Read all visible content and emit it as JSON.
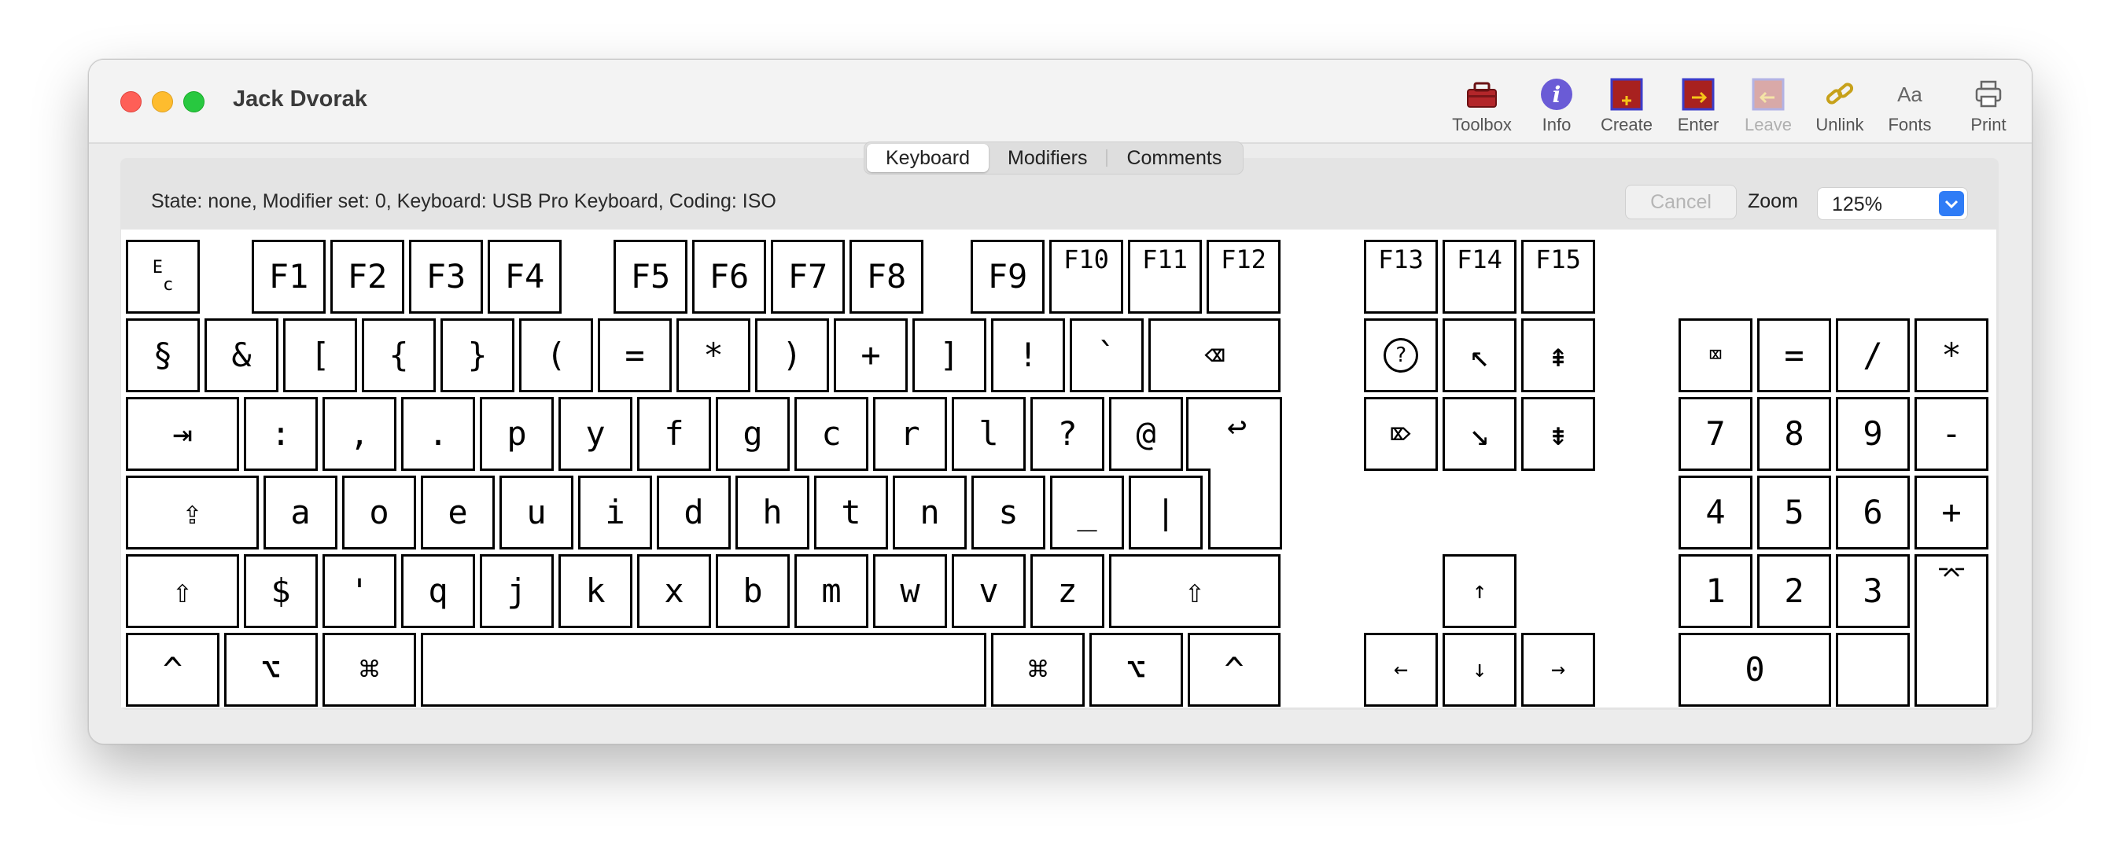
{
  "window": {
    "title": "Jack Dvorak"
  },
  "toolbar": [
    {
      "name": "toolbox",
      "label": "Toolbox",
      "icon": "toolbox-icon",
      "disabled": false
    },
    {
      "name": "info",
      "label": "Info",
      "icon": "info-icon",
      "disabled": false
    },
    {
      "name": "create",
      "label": "Create",
      "icon": "create-icon",
      "disabled": false
    },
    {
      "name": "enter",
      "label": "Enter",
      "icon": "enter-icon",
      "disabled": false
    },
    {
      "name": "leave",
      "label": "Leave",
      "icon": "leave-icon",
      "disabled": true
    },
    {
      "name": "unlink",
      "label": "Unlink",
      "icon": "unlink-icon",
      "disabled": false
    },
    {
      "name": "fonts",
      "label": "Fonts",
      "icon": "fonts-icon",
      "disabled": false
    },
    {
      "name": "print",
      "label": "Print",
      "icon": "print-icon",
      "disabled": false
    }
  ],
  "fonts_icon_text": "Aa",
  "tabs": [
    {
      "label": "Keyboard",
      "active": true
    },
    {
      "label": "Modifiers",
      "active": false
    },
    {
      "label": "Comments",
      "active": false
    }
  ],
  "status": "State: none, Modifier set: 0, Keyboard: USB Pro Keyboard, Coding: ISO",
  "cancel_label": "Cancel",
  "zoom": {
    "label": "Zoom",
    "value": "125%"
  },
  "keys": {
    "esc": "E\n c",
    "f1": "F1",
    "f2": "F2",
    "f3": "F3",
    "f4": "F4",
    "f5": "F5",
    "f6": "F6",
    "f7": "F7",
    "f8": "F8",
    "f9": "F9",
    "f10": "F10",
    "f11": "F11",
    "f12": "F12",
    "f13": "F13",
    "f14": "F14",
    "f15": "F15",
    "r1": [
      "§",
      "&",
      "[",
      "{",
      "}",
      "(",
      "=",
      "*",
      ")",
      "+",
      "]",
      "!",
      "`"
    ],
    "delete": "⌫",
    "tab": "⇥",
    "r2": [
      ":",
      ",",
      ".",
      "p",
      "y",
      "f",
      "g",
      "c",
      "r",
      "l",
      "?",
      "@"
    ],
    "return": "↩",
    "caps": "⇪",
    "r3": [
      "a",
      "o",
      "e",
      "u",
      "i",
      "d",
      "h",
      "t",
      "n",
      "s",
      "_",
      "|"
    ],
    "shift_l": "⇧",
    "r4": [
      "$",
      "'",
      "q",
      "j",
      "k",
      "x",
      "b",
      "m",
      "w",
      "v",
      "z"
    ],
    "shift_r": "⇧",
    "ctrl_l": "^",
    "opt_l": "⌥",
    "cmd_l": "⌘",
    "space": "",
    "cmd_r": "⌘",
    "opt_r": "⌥",
    "ctrl_r": "^",
    "help": "?",
    "home": "↖",
    "pgup": "⇞",
    "fwd_del": "⌦",
    "end": "↘",
    "pgdn": "⇟",
    "up": "↑",
    "left": "←",
    "down": "↓",
    "right": "→",
    "np_clear": "⌧",
    "np_row1": [
      "=",
      "/",
      "*"
    ],
    "np_row2": [
      "7",
      "8",
      "9",
      "-"
    ],
    "np_row3": [
      "4",
      "5",
      "6",
      "+"
    ],
    "np_row4": [
      "1",
      "2",
      "3"
    ],
    "np_enter": "⌤",
    "np_0": "0",
    "np_dot": ""
  }
}
